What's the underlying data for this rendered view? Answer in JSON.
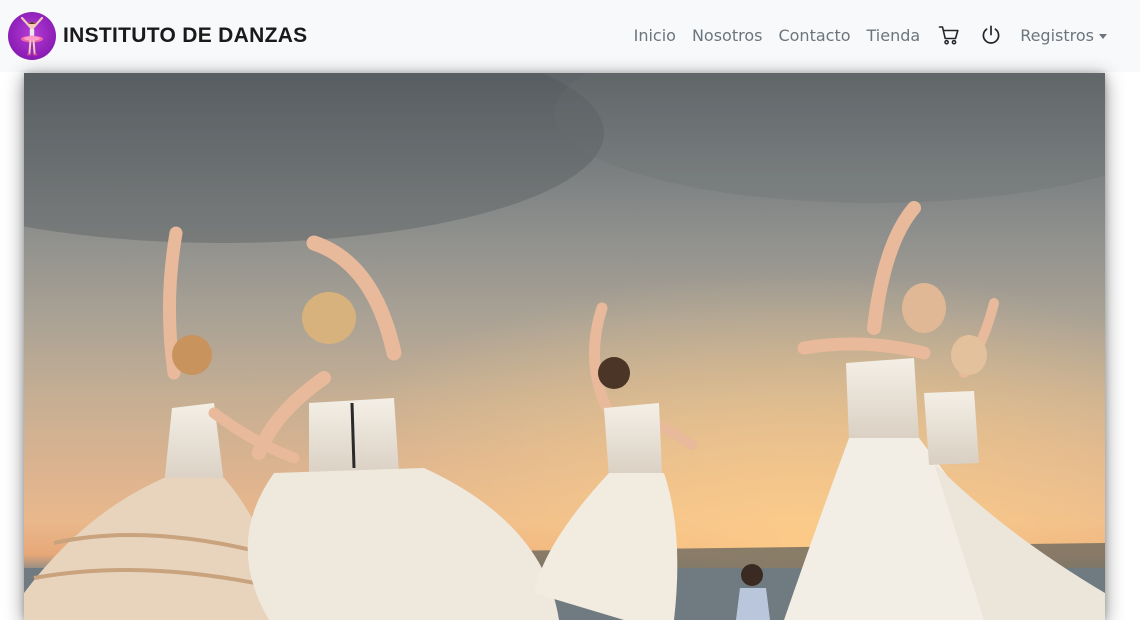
{
  "brand": {
    "title": "INSTITUTO DE DANZAS",
    "logo_icon": "ballerina-logo-icon",
    "logo_color": "#8a1cb5"
  },
  "nav": {
    "items": [
      {
        "label": "Inicio"
      },
      {
        "label": "Nosotros"
      },
      {
        "label": "Contacto"
      },
      {
        "label": "Tienda"
      }
    ],
    "cart_icon": "cart-icon",
    "power_icon": "power-icon",
    "dropdown_label": "Registros",
    "text_color": "#6c757d"
  },
  "hero": {
    "image": "ballet-dancers-sunset-photo"
  }
}
